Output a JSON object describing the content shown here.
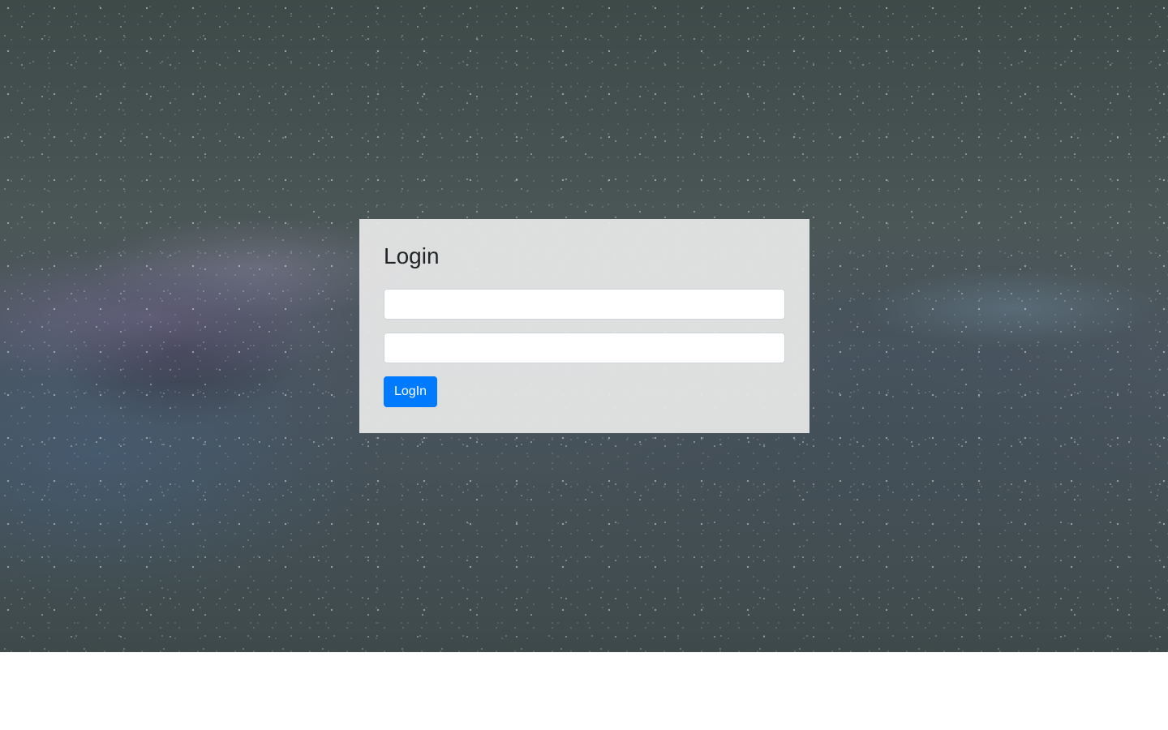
{
  "login": {
    "title": "Login",
    "username_value": "",
    "password_value": "",
    "button_label": "LogIn"
  },
  "colors": {
    "button_primary": "#007bff",
    "card_background": "#e8e8e8",
    "page_background": "#ffffff"
  }
}
